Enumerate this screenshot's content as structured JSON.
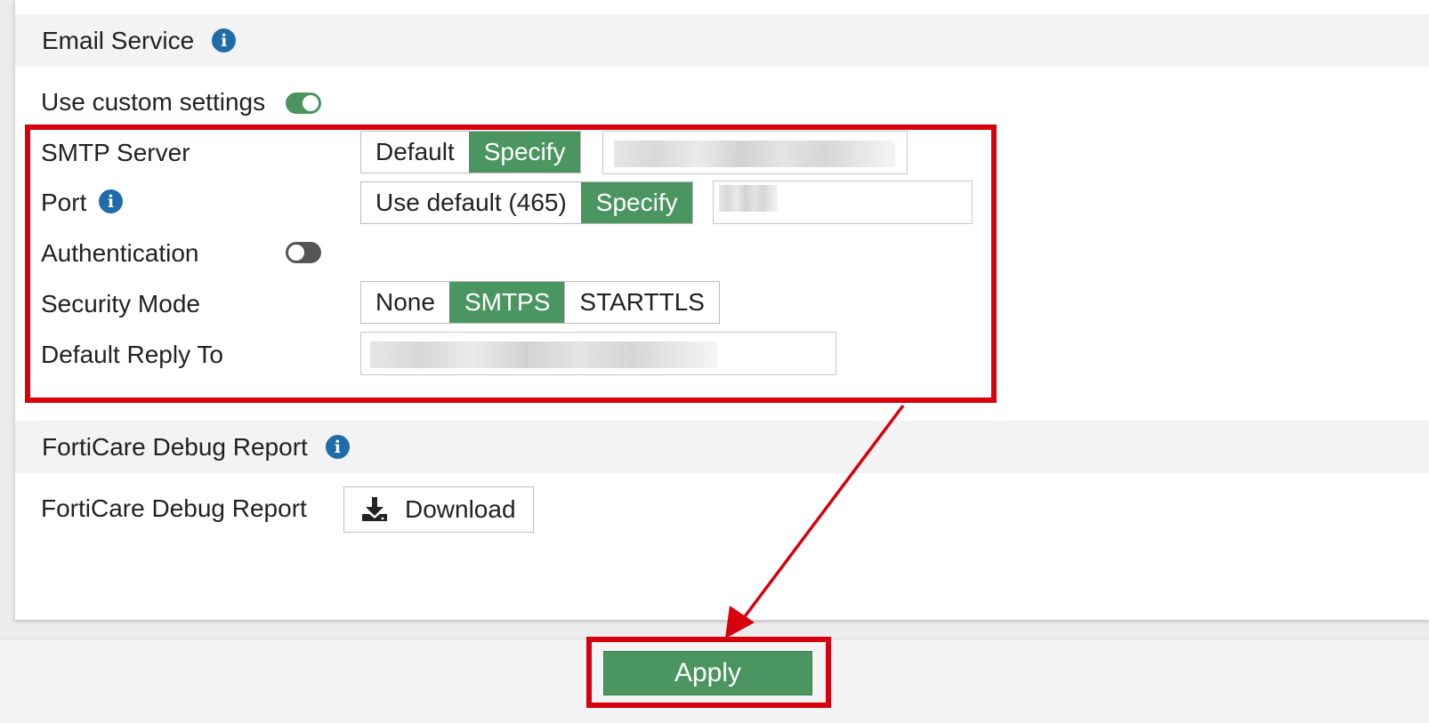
{
  "email_section": {
    "title": "Email Service",
    "use_custom_label": "Use custom settings",
    "use_custom_enabled": true,
    "smtp_server": {
      "label": "SMTP Server",
      "options": [
        "Default",
        "Specify"
      ],
      "selected": "Specify"
    },
    "port": {
      "label": "Port",
      "options": [
        "Use default (465)",
        "Specify"
      ],
      "selected": "Specify"
    },
    "authentication": {
      "label": "Authentication",
      "enabled": false
    },
    "security_mode": {
      "label": "Security Mode",
      "options": [
        "None",
        "SMTPS",
        "STARTTLS"
      ],
      "selected": "SMTPS"
    },
    "default_reply_to": {
      "label": "Default Reply To"
    }
  },
  "forticare_section": {
    "title": "FortiCare Debug Report",
    "row_label": "FortiCare Debug Report",
    "download_label": "Download"
  },
  "footer": {
    "apply_label": "Apply"
  },
  "colors": {
    "accent_green": "#4b9560",
    "info_blue": "#1f6ca8",
    "highlight_red": "#d9000d"
  }
}
